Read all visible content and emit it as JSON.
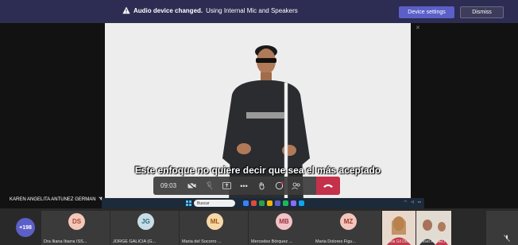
{
  "banner": {
    "title": "Audio device changed.",
    "message": "Using Internal Mic and Speakers",
    "device_settings_label": "Device settings",
    "dismiss_label": "Dismiss"
  },
  "video": {
    "subtitle_line1": "Este enfoque no quiere decir que sea el más aceptado",
    "subtitle_line2": "",
    "presenter_name": "KAREN ANGELITA ANTUNEZ GERMAN"
  },
  "controls": {
    "timer": "09:03"
  },
  "taskbar": {
    "search_placeholder": "Buscar"
  },
  "participants": {
    "more_count": "+198",
    "tiles": [
      {
        "initials": "DS",
        "name": "Dra Iliana Ibarra ISS...",
        "bg": "#f4c7ba",
        "fg": "#a34a2f"
      },
      {
        "initials": "JG",
        "name": "JORGE GALICIA (G...",
        "bg": "#c8dde5",
        "fg": "#2f6a80"
      },
      {
        "initials": "ML",
        "name": "Maria del Socorro ...",
        "bg": "#f7d8a8",
        "fg": "#9a5a12"
      },
      {
        "initials": "MB",
        "name": "Mercedes Bórquez ...",
        "bg": "#f2c2c6",
        "fg": "#9a3240"
      },
      {
        "initials": "MZ",
        "name": "Maria Dolores Figu...",
        "bg": "#f5c5bd",
        "fg": "#9a3a2a"
      }
    ],
    "video_tiles": [
      {
        "name": "Gloria Gil Dolfo"
      },
      {
        "name": "Arliset ANGELITA"
      }
    ]
  },
  "colors": {
    "banner_bg": "#2d2c52",
    "accent": "#5b5fc7",
    "hangup": "#c4314b"
  }
}
